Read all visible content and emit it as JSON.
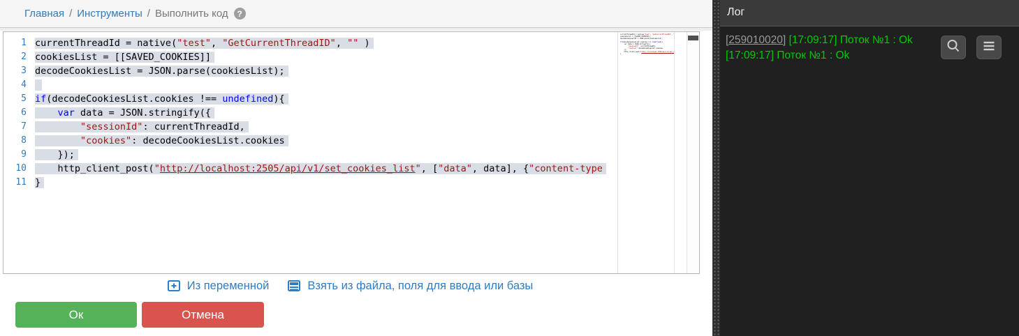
{
  "breadcrumb": {
    "items": [
      {
        "label": "Главная"
      },
      {
        "label": "Инструменты"
      },
      {
        "label": "Выполнить код"
      }
    ],
    "separator": "/",
    "help_icon": "question-circle-icon",
    "help_glyph": "?"
  },
  "editor": {
    "lines": [
      {
        "num": "1",
        "segments": [
          {
            "type": "plain",
            "text": "currentThreadId = native("
          },
          {
            "type": "str",
            "text": "\"test\""
          },
          {
            "type": "plain",
            "text": ", "
          },
          {
            "type": "str",
            "text": "\"GetCurrentThreadID\""
          },
          {
            "type": "plain",
            "text": ", "
          },
          {
            "type": "str",
            "text": "\"\""
          },
          {
            "type": "plain",
            "text": " )"
          }
        ]
      },
      {
        "num": "2",
        "segments": [
          {
            "type": "plain",
            "text": "cookiesList = [[SAVED_COOKIES]]"
          }
        ]
      },
      {
        "num": "3",
        "segments": [
          {
            "type": "plain",
            "text": "decodeCookiesList = JSON.parse(cookiesList);"
          }
        ]
      },
      {
        "num": "4",
        "segments": []
      },
      {
        "num": "5",
        "segments": [
          {
            "type": "kw",
            "text": "if"
          },
          {
            "type": "plain",
            "text": "(decodeCookiesList.cookies !== "
          },
          {
            "type": "kw",
            "text": "undefined"
          },
          {
            "type": "plain",
            "text": "){"
          }
        ]
      },
      {
        "num": "6",
        "segments": [
          {
            "type": "plain",
            "text": "    "
          },
          {
            "type": "kw",
            "text": "var"
          },
          {
            "type": "plain",
            "text": " data = JSON.stringify({"
          }
        ]
      },
      {
        "num": "7",
        "segments": [
          {
            "type": "plain",
            "text": "        "
          },
          {
            "type": "str",
            "text": "\"sessionId\""
          },
          {
            "type": "plain",
            "text": ": currentThreadId,"
          }
        ]
      },
      {
        "num": "8",
        "segments": [
          {
            "type": "plain",
            "text": "        "
          },
          {
            "type": "str",
            "text": "\"cookies\""
          },
          {
            "type": "plain",
            "text": ": decodeCookiesList.cookies"
          }
        ]
      },
      {
        "num": "9",
        "segments": [
          {
            "type": "plain",
            "text": "    });"
          }
        ]
      },
      {
        "num": "10",
        "segments": [
          {
            "type": "plain",
            "text": "    http_client_post("
          },
          {
            "type": "str",
            "text": "\""
          },
          {
            "type": "url",
            "text": "http://localhost:2505/api/v1/set_cookies_list"
          },
          {
            "type": "str",
            "text": "\""
          },
          {
            "type": "plain",
            "text": ", ["
          },
          {
            "type": "str",
            "text": "\"data\""
          },
          {
            "type": "plain",
            "text": ", data], {"
          },
          {
            "type": "str",
            "text": "\"content-type"
          }
        ]
      },
      {
        "num": "11",
        "segments": [
          {
            "type": "plain",
            "text": "}"
          }
        ]
      }
    ]
  },
  "actions": {
    "from_variable": {
      "label": "Из переменной",
      "icon": "plus-square-icon"
    },
    "from_file": {
      "label": "Взять из файла, поля для ввода или базы",
      "icon": "form-rows-icon"
    },
    "ok_label": "Ок",
    "cancel_label": "Отмена"
  },
  "log": {
    "title": "Лог",
    "entries": [
      {
        "link": "[259010020]",
        "text": " [17:09:17] Поток №1 : Ok"
      },
      {
        "link": "",
        "text": "[17:09:17] Поток №1 : Ok"
      }
    ],
    "buttons": [
      {
        "icon": "search-icon"
      },
      {
        "icon": "menu-icon"
      }
    ]
  },
  "colors": {
    "ok_button": "#55b259",
    "cancel_button": "#d9534f",
    "link_blue": "#337ab7",
    "action_blue": "#2e7cc2",
    "log_text_green": "#00cc00",
    "log_id_gray": "#9a9a9a",
    "string_red": "#a31515",
    "keyword_blue": "#0000ff",
    "selection": "#d9dee6",
    "log_panel_bg": "#3a3a3a",
    "log_content_bg": "#202020"
  }
}
